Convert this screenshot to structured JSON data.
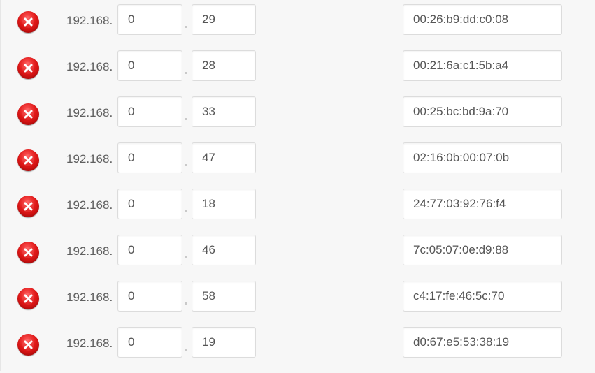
{
  "ip_prefix": "192.168.",
  "icons": {
    "delete": "delete-x-icon"
  },
  "colors": {
    "delete_red": "#e01818",
    "background": "#f7f7f7"
  },
  "reservations": [
    {
      "ip_prefix": "192.168.",
      "octet3": "0",
      "octet4": "29",
      "mac": "00:26:b9:dd:c0:08"
    },
    {
      "ip_prefix": "192.168.",
      "octet3": "0",
      "octet4": "28",
      "mac": "00:21:6a:c1:5b:a4"
    },
    {
      "ip_prefix": "192.168.",
      "octet3": "0",
      "octet4": "33",
      "mac": "00:25:bc:bd:9a:70"
    },
    {
      "ip_prefix": "192.168.",
      "octet3": "0",
      "octet4": "47",
      "mac": "02:16:0b:00:07:0b"
    },
    {
      "ip_prefix": "192.168.",
      "octet3": "0",
      "octet4": "18",
      "mac": "24:77:03:92:76:f4"
    },
    {
      "ip_prefix": "192.168.",
      "octet3": "0",
      "octet4": "46",
      "mac": "7c:05:07:0e:d9:88"
    },
    {
      "ip_prefix": "192.168.",
      "octet3": "0",
      "octet4": "58",
      "mac": "c4:17:fe:46:5c:70"
    },
    {
      "ip_prefix": "192.168.",
      "octet3": "0",
      "octet4": "19",
      "mac": "d0:67:e5:53:38:19"
    }
  ]
}
